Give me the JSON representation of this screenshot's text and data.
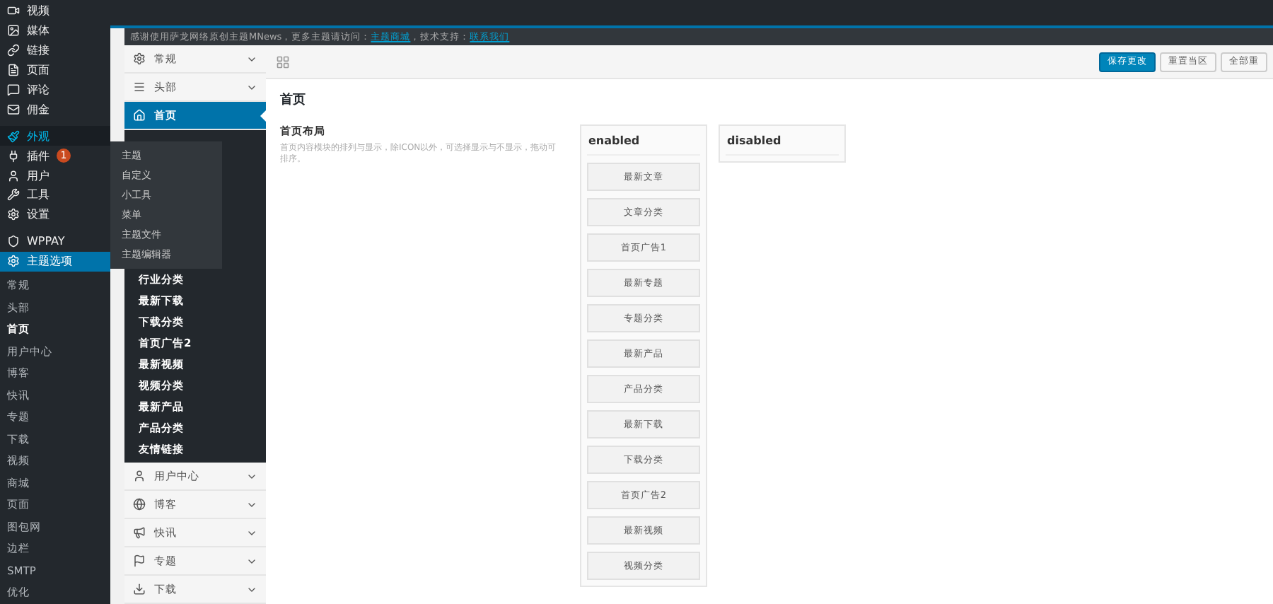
{
  "admin_menu": {
    "items": [
      {
        "label": "视频",
        "selected": false,
        "open": false
      },
      {
        "label": "媒体",
        "selected": false,
        "open": false
      },
      {
        "label": "链接",
        "selected": false,
        "open": false
      },
      {
        "label": "页面",
        "selected": false,
        "open": false
      },
      {
        "label": "评论",
        "selected": false,
        "open": false
      },
      {
        "label": "佣金",
        "selected": false,
        "open": false
      },
      {
        "label": "外观",
        "selected": false,
        "open": true
      },
      {
        "label": "插件",
        "selected": false,
        "open": false,
        "badge": "1"
      },
      {
        "label": "用户",
        "selected": false,
        "open": false
      },
      {
        "label": "工具",
        "selected": false,
        "open": false
      },
      {
        "label": "设置",
        "selected": false,
        "open": false
      },
      {
        "label": "WPPAY",
        "selected": false,
        "open": false
      },
      {
        "label": "主题选项",
        "selected": true,
        "open": false
      }
    ],
    "submenu": [
      {
        "label": "常规",
        "selected": false
      },
      {
        "label": "头部",
        "selected": false
      },
      {
        "label": "首页",
        "selected": true
      },
      {
        "label": "用户中心",
        "selected": false
      },
      {
        "label": "博客",
        "selected": false
      },
      {
        "label": "快讯",
        "selected": false
      },
      {
        "label": "专题",
        "selected": false
      },
      {
        "label": "下载",
        "selected": false
      },
      {
        "label": "视频",
        "selected": false
      },
      {
        "label": "商城",
        "selected": false
      },
      {
        "label": "页面",
        "selected": false
      },
      {
        "label": "图包网",
        "selected": false
      },
      {
        "label": "边栏",
        "selected": false
      },
      {
        "label": "SMTP",
        "selected": false
      },
      {
        "label": "优化",
        "selected": false
      }
    ],
    "flyout": [
      "主题",
      "自定义",
      "小工具",
      "菜单",
      "主题文件",
      "主题编辑器"
    ]
  },
  "notice": [
    {
      "text": "感谢使用萨龙网络原创主题MNews，更多主题请访问：",
      "link": false
    },
    {
      "text": "主题商城",
      "link": true
    },
    {
      "text": "，技术支持：",
      "link": false
    },
    {
      "text": "联系我们",
      "link": true
    }
  ],
  "options_nav": [
    {
      "label": "常规",
      "selected": false,
      "expanded": false
    },
    {
      "label": "头部",
      "selected": false,
      "expanded": false
    },
    {
      "label": "首页",
      "selected": true,
      "expanded": true,
      "children": [
        "行业分类",
        "最新下载",
        "下载分类",
        "首页广告2",
        "最新视频",
        "视频分类",
        "最新产品",
        "产品分类",
        "友情链接"
      ]
    },
    {
      "label": "用户中心",
      "selected": false,
      "expanded": false
    },
    {
      "label": "博客",
      "selected": false,
      "expanded": false
    },
    {
      "label": "快讯",
      "selected": false,
      "expanded": false
    },
    {
      "label": "专题",
      "selected": false,
      "expanded": false
    },
    {
      "label": "下载",
      "selected": false,
      "expanded": false
    }
  ],
  "toolbar_buttons": [
    {
      "label": "保存更改",
      "kind": "primary"
    },
    {
      "label": "重置当区",
      "kind": "default"
    },
    {
      "label": "全部重",
      "kind": "default"
    }
  ],
  "section": {
    "title": "首页",
    "field": {
      "label": "首页布局",
      "description": "首页内容模块的排列与显示，除ICON以外，可选择显示与不显示，拖动可排序。",
      "enabled": {
        "title": "enabled",
        "items": [
          "最新文章",
          "文章分类",
          "首页广告1",
          "最新专题",
          "专题分类",
          "最新产品",
          "产品分类",
          "最新下载",
          "下载分类",
          "首页广告2",
          "最新视频",
          "视频分类"
        ]
      },
      "disabled": {
        "title": "disabled"
      }
    }
  }
}
